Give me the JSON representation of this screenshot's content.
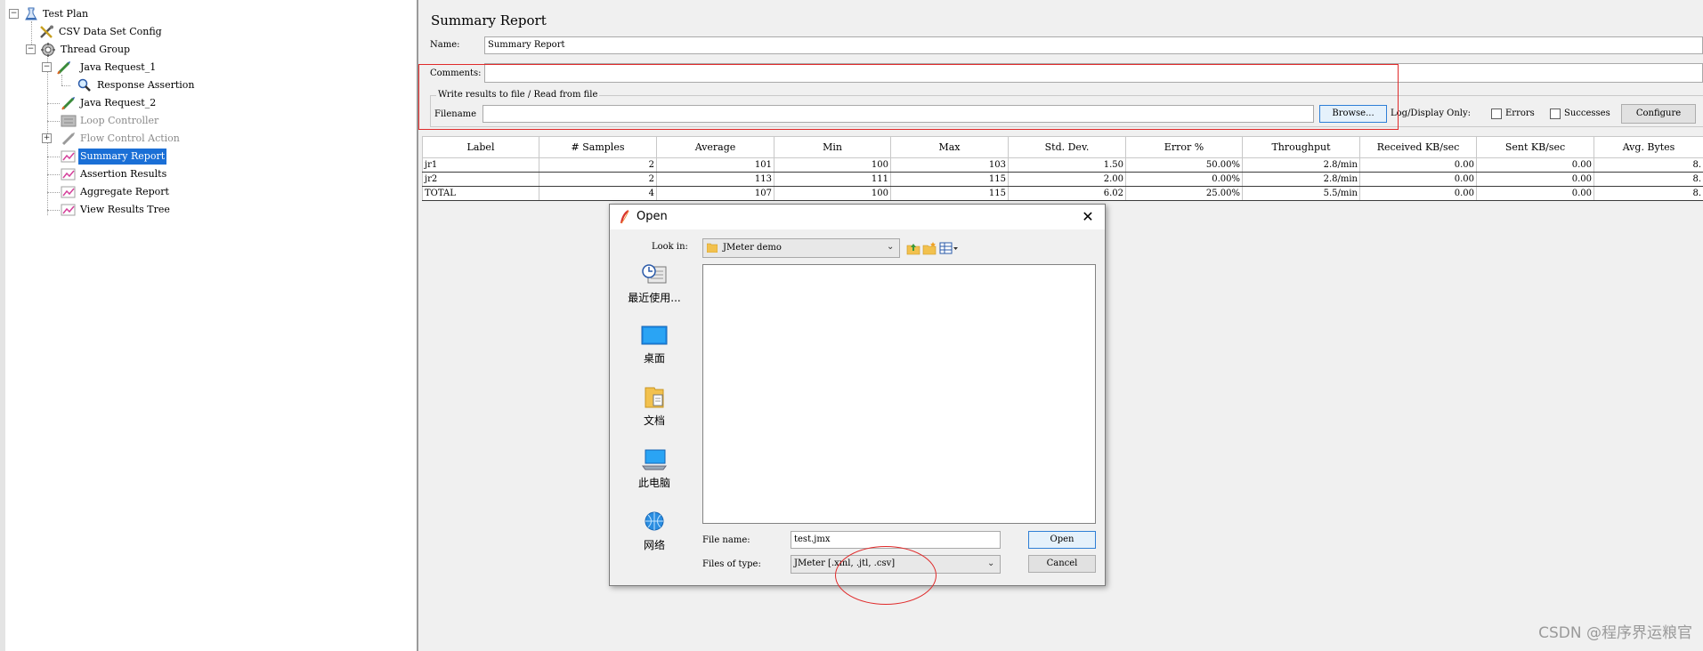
{
  "tree": {
    "items": [
      {
        "label": "Test Plan",
        "icon": "test-plan-icon"
      },
      {
        "label": "CSV Data Set Config",
        "icon": "csv-config-icon"
      },
      {
        "label": "Thread Group",
        "icon": "thread-group-icon"
      },
      {
        "label": "Java Request_1",
        "icon": "java-request-icon"
      },
      {
        "label": "Response Assertion",
        "icon": "magnifier-icon"
      },
      {
        "label": "Java Request_2",
        "icon": "java-request-icon"
      },
      {
        "label": "Loop Controller",
        "icon": "loop-controller-icon"
      },
      {
        "label": "Flow Control Action",
        "icon": "flow-control-icon"
      },
      {
        "label": "Summary Report",
        "icon": "report-icon"
      },
      {
        "label": "Assertion Results",
        "icon": "report-icon"
      },
      {
        "label": "Aggregate Report",
        "icon": "report-icon"
      },
      {
        "label": "View Results Tree",
        "icon": "report-icon"
      }
    ]
  },
  "report": {
    "title": "Summary Report",
    "name_label": "Name:",
    "name_value": "Summary Report",
    "comments_label": "Comments:",
    "comments_value": "",
    "file_group_legend": "Write results to file / Read from file",
    "filename_label": "Filename",
    "filename_value": "",
    "browse_label": "Browse...",
    "log_display_label": "Log/Display Only:",
    "errors_label": "Errors",
    "successes_label": "Successes",
    "configure_label": "Configure"
  },
  "table": {
    "headers": [
      "Label",
      "# Samples",
      "Average",
      "Min",
      "Max",
      "Std. Dev.",
      "Error %",
      "Throughput",
      "Received KB/sec",
      "Sent KB/sec",
      "Avg. Bytes"
    ],
    "rows": [
      [
        "jr1",
        "2",
        "101",
        "100",
        "103",
        "1.50",
        "50.00%",
        "2.8/min",
        "0.00",
        "0.00",
        "8."
      ],
      [
        "jr2",
        "2",
        "113",
        "111",
        "115",
        "2.00",
        "0.00%",
        "2.8/min",
        "0.00",
        "0.00",
        "8."
      ],
      [
        "TOTAL",
        "4",
        "107",
        "100",
        "115",
        "6.02",
        "25.00%",
        "5.5/min",
        "0.00",
        "0.00",
        "8."
      ]
    ]
  },
  "dialog": {
    "title": "Open",
    "look_in_label": "Look in:",
    "look_in_value": "JMeter demo",
    "places": [
      {
        "label": "最近使用...",
        "icon": "recent-icon"
      },
      {
        "label": "桌面",
        "icon": "desktop-icon"
      },
      {
        "label": "文档",
        "icon": "documents-icon"
      },
      {
        "label": "此电脑",
        "icon": "computer-icon"
      },
      {
        "label": "网络",
        "icon": "network-icon"
      }
    ],
    "file_name_label": "File name:",
    "file_name_value": "test.jmx",
    "files_of_type_label": "Files of type:",
    "files_of_type_value": "JMeter [.xml, .jtl, .csv]",
    "open_label": "Open",
    "cancel_label": "Cancel"
  },
  "watermark": "CSDN @程序界运粮官",
  "colors": {
    "selection": "#1a6fd6",
    "annotation_red": "#e02a2a",
    "focus_blue": "#2f7fd6"
  }
}
